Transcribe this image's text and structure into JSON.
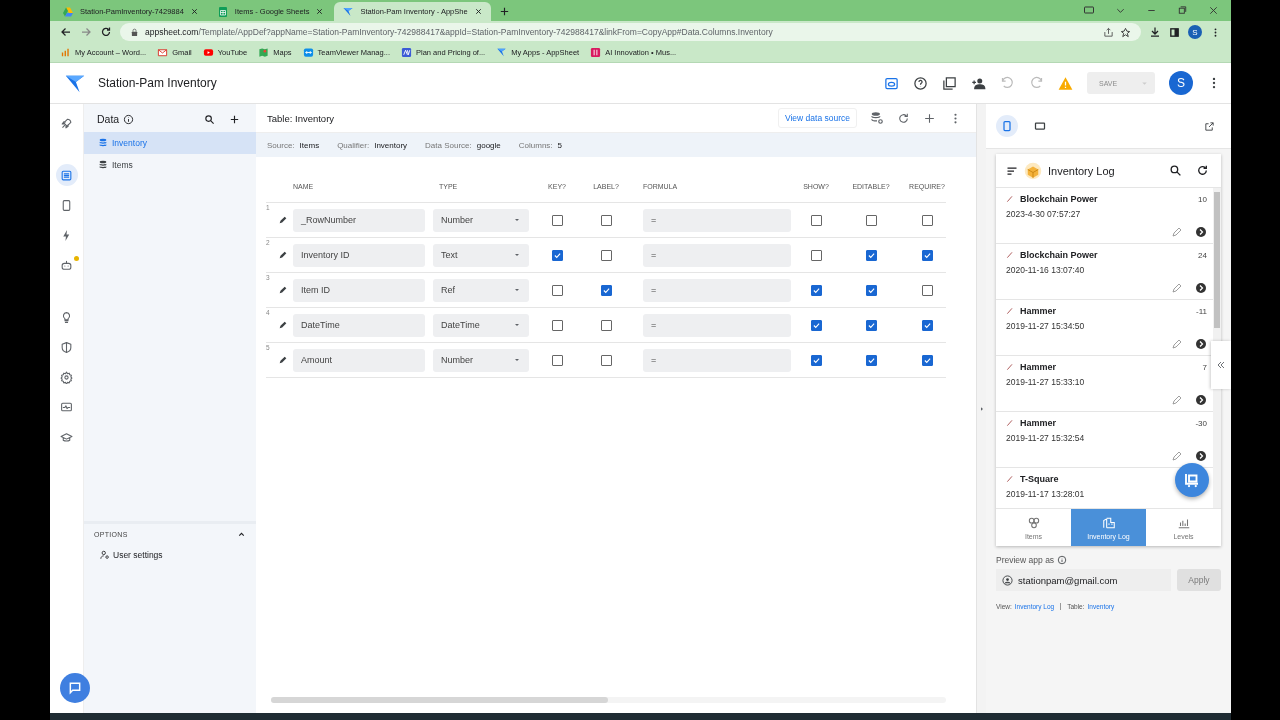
{
  "browser": {
    "tabs": [
      {
        "title": "Station-PamInventory-7429884",
        "kind": "drive",
        "selected": false
      },
      {
        "title": "Items - Google Sheets",
        "kind": "sheets",
        "selected": false
      },
      {
        "title": "Station-Pam Inventory - AppShe",
        "kind": "appsheet",
        "selected": true
      }
    ],
    "url_host": "appsheet.com",
    "url_path": "/Template/AppDef?appName=Station-PamInventory-742988417&appId=Station-PamInventory-742988417&linkFrom=CopyApp#Data.Columns.Inventory",
    "account": "S",
    "bookmarks": [
      {
        "label": "My Account – Word...",
        "kind": "bars"
      },
      {
        "label": "Gmail",
        "kind": "mail"
      },
      {
        "label": "YouTube",
        "kind": "play"
      },
      {
        "label": "Maps",
        "kind": "map"
      },
      {
        "label": "TeamViewer Manag...",
        "kind": "tv"
      },
      {
        "label": "Plan and Pricing of...",
        "kind": "av"
      },
      {
        "label": "My Apps - AppSheet",
        "kind": "appsheet"
      },
      {
        "label": "AI Innovation • Mus...",
        "kind": "pink"
      }
    ]
  },
  "app": {
    "title": "Station-Pam Inventory",
    "save": {
      "label": "SAVE",
      "disabled": true
    },
    "avatar": "S"
  },
  "rail": [
    {
      "kind": "rocket",
      "selected": false,
      "notified": false
    },
    {
      "kind": "data",
      "selected": true,
      "notified": false
    },
    {
      "kind": "phone",
      "selected": false,
      "notified": false
    },
    {
      "kind": "bolt",
      "selected": false,
      "notified": false
    },
    {
      "kind": "bot",
      "selected": false,
      "notified": true
    },
    {
      "kind": "bulb",
      "selected": false,
      "notified": false
    },
    {
      "kind": "shield",
      "selected": false,
      "notified": false
    },
    {
      "kind": "gear",
      "selected": false,
      "notified": false
    },
    {
      "kind": "monitor",
      "selected": false,
      "notified": false
    },
    {
      "kind": "cap",
      "selected": false,
      "notified": false
    }
  ],
  "data_panel": {
    "title": "Data",
    "tables": [
      {
        "name": "Inventory",
        "selected": true
      },
      {
        "name": "Items",
        "selected": false
      }
    ],
    "options": {
      "title": "OPTIONS",
      "expanded": true,
      "items": [
        "User settings"
      ]
    }
  },
  "table": {
    "title": "Table: Inventory",
    "view_source": "View data source",
    "meta": [
      {
        "label": "Source:",
        "value": "Items"
      },
      {
        "label": "Qualifier:",
        "value": "Inventory"
      },
      {
        "label": "Data Source:",
        "value": "google"
      },
      {
        "label": "Columns:",
        "value": "5"
      }
    ],
    "columns": [
      "NAME",
      "TYPE",
      "KEY?",
      "LABEL?",
      "FORMULA",
      "SHOW?",
      "EDITABLE?",
      "REQUIRE?"
    ],
    "rows": [
      {
        "number": "1",
        "name": "_RowNumber",
        "type": "Number",
        "key": false,
        "label": false,
        "formula": "=",
        "show": false,
        "editable": false,
        "require": false
      },
      {
        "number": "2",
        "name": "Inventory ID",
        "type": "Text",
        "key": true,
        "label": false,
        "formula": "=",
        "show": false,
        "editable": true,
        "require": true
      },
      {
        "number": "3",
        "name": "Item ID",
        "type": "Ref",
        "key": false,
        "label": true,
        "formula": "=",
        "show": true,
        "editable": true,
        "require": false
      },
      {
        "number": "4",
        "name": "DateTime",
        "type": "DateTime",
        "key": false,
        "label": false,
        "formula": "=",
        "show": true,
        "editable": true,
        "require": true
      },
      {
        "number": "5",
        "name": "Amount",
        "type": "Number",
        "key": false,
        "label": false,
        "formula": "=",
        "show": true,
        "editable": true,
        "require": true
      }
    ]
  },
  "preview": {
    "app_title": "Inventory Log",
    "entries": [
      {
        "title": "Blockchain Power",
        "time": "2023-4-30 07:57:27",
        "value": "10"
      },
      {
        "title": "Blockchain Power",
        "time": "2020-11-16 13:07:40",
        "value": "24"
      },
      {
        "title": "Hammer",
        "time": "2019-11-27 15:34:50",
        "value": "-11"
      },
      {
        "title": "Hammer",
        "time": "2019-11-27 15:33:10",
        "value": "7"
      },
      {
        "title": "Hammer",
        "time": "2019-11-27 15:32:54",
        "value": "-30"
      },
      {
        "title": "T-Square",
        "time": "2019-11-17 13:28:01"
      }
    ],
    "nav": [
      {
        "label": "Items",
        "kind": "items",
        "selected": false
      },
      {
        "label": "Inventory Log",
        "kind": "log",
        "selected": true
      },
      {
        "label": "Levels",
        "kind": "levels",
        "selected": false
      }
    ],
    "preview_as": "Preview app as",
    "email": "stationpam@gmail.com",
    "apply": {
      "label": "Apply",
      "disabled": true
    },
    "footer": [
      {
        "label": "View:",
        "link": "Inventory Log"
      },
      {
        "label": "Table:",
        "link": "Inventory"
      }
    ]
  }
}
